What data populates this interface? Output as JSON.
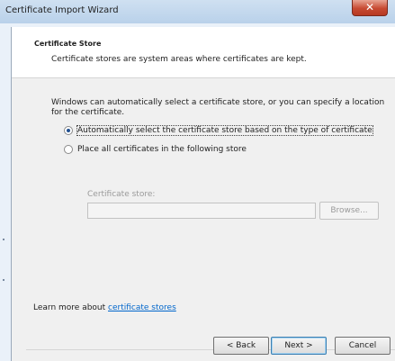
{
  "window": {
    "title": "Certificate Import Wizard",
    "close_symbol": "✕"
  },
  "header": {
    "title": "Certificate Store",
    "description": "Certificate stores are system areas where certificates are kept."
  },
  "body": {
    "intro": "Windows can automatically select a certificate store, or you can specify a location for the certificate.",
    "options": [
      {
        "label": "Automatically select the certificate store based on the type of certificate",
        "selected": true
      },
      {
        "label": "Place all certificates in the following store",
        "selected": false
      }
    ],
    "store_label": "Certificate store:",
    "store_value": "",
    "browse_label": "Browse...",
    "learn_prefix": "Learn more about ",
    "learn_link": "certificate stores"
  },
  "footer": {
    "back_label": "< Back",
    "next_label": "Next >",
    "cancel_label": "Cancel"
  }
}
